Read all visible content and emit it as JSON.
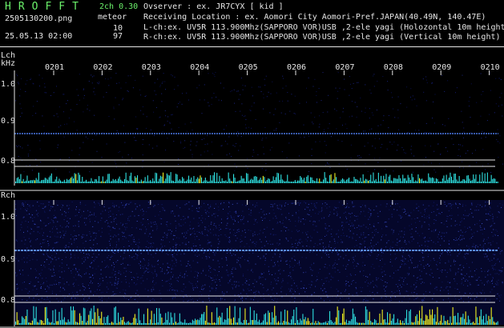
{
  "header": {
    "app_title": "HROFFT",
    "mode": "2ch 0.30",
    "filename": "2505130200.png",
    "meteor_label": "meteor",
    "timestamp": "25.05.13 02:00",
    "count_lch": "10",
    "count_rch": "97"
  },
  "info": {
    "observer": "Ovserver           : ex. JR7CYX [ kid ]",
    "location": "Receiving Location : ex. Aomori City Aomori-Pref.JAPAN(40.49N, 140.47E)",
    "lch": "L-ch:ex. UV5R 113.900Mhz(SAPPORO VOR)USB ,2-ele yagi (Holozontal 10m height)",
    "rch": "R-ch:ex. UV5R 113.900Mhz(SAPPORO VOR)USB ,2-ele yagi (Vertical 10m height)"
  },
  "axis": {
    "lch_label": "Lch",
    "unit": "kHz",
    "rch_label": "Rch",
    "time_ticks": [
      "0201",
      "0202",
      "0203",
      "0204",
      "0205",
      "0206",
      "0207",
      "0208",
      "0209",
      "0210"
    ],
    "lch_freq_ticks": [
      "1.0",
      "0.9",
      "0.8"
    ],
    "rch_freq_ticks": [
      "1.0",
      "0.9",
      "0.8"
    ]
  },
  "colors": {
    "green": "#6bf16b",
    "text": "#e6e6e6",
    "noise_blue": "#1e2a8c",
    "signal_blue": "#4a78e6",
    "bar_cyan": "#2ee0e0",
    "bar_yellow": "#f0f020"
  }
}
